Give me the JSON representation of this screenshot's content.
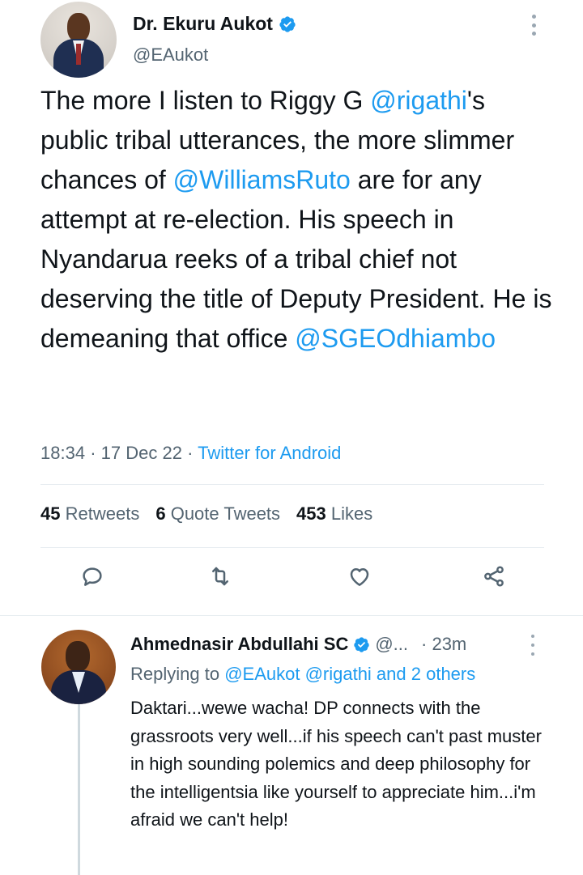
{
  "tweet": {
    "author": {
      "display_name": "Dr. Ekuru Aukot",
      "handle": "@EAukot",
      "verified": true
    },
    "text_parts": [
      "The more I listen to Riggy G ",
      "@rigathi",
      "'s public tribal utterances, the more slimmer chances of ",
      "@WilliamsRuto",
      " are for any attempt at re-election. His speech in Nyandarua reeks of a tribal chief not deserving the title of Deputy President. He is demeaning that office ",
      "@SGEOdhiambo"
    ],
    "time": "18:34",
    "date": "17 Dec 22",
    "source": "Twitter for Android",
    "stats": {
      "retweets_count": "45",
      "retweets_label": "Retweets",
      "quotes_count": "6",
      "quotes_label": "Quote Tweets",
      "likes_count": "453",
      "likes_label": "Likes"
    }
  },
  "actions": [
    "reply-icon",
    "retweet-icon",
    "like-icon",
    "share-icon"
  ],
  "reply": {
    "author": {
      "display_name": "Ahmednasir Abdullahi SC",
      "handle": "@...",
      "verified": true
    },
    "time": "23m",
    "replying_prefix": "Replying to ",
    "replying_mentions": "@EAukot @rigathi and 2 others",
    "text": "Daktari...wewe wacha! DP connects with the grassroots very well...if his speech can't past muster in high sounding polemics and deep philosophy for the intelligentsia like yourself to appreciate him...i'm afraid we can't help!"
  },
  "colors": {
    "accent": "#1d9bf0",
    "secondary_text": "#536471",
    "primary_text": "#0f1419"
  }
}
